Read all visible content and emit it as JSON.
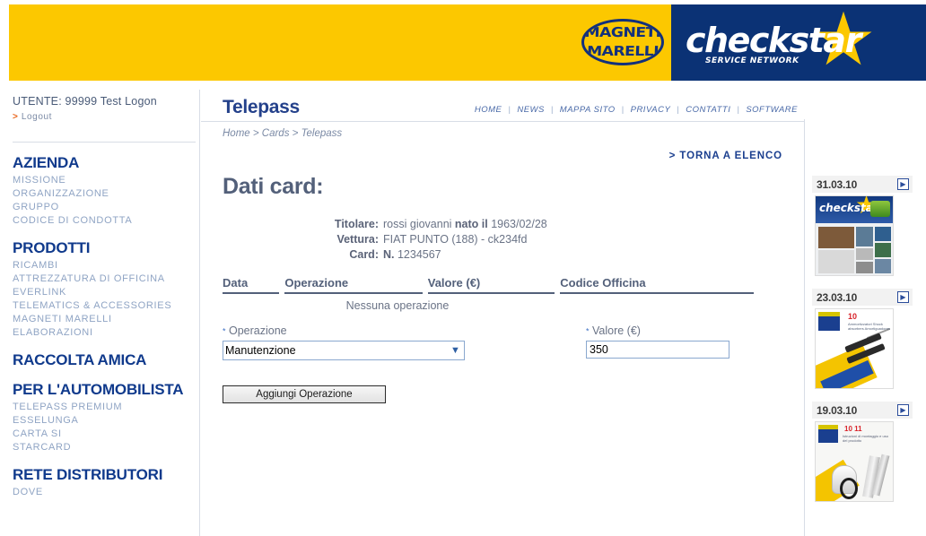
{
  "header": {
    "magneti_line1": "MAGNETI",
    "magneti_line2": "MARELLI",
    "checkstar_word": "checkstar",
    "checkstar_sub": "SERVICE NETWORK",
    "yellow": "#fcc800",
    "blue": "#0b3275"
  },
  "sidebar": {
    "user_label": "UTENTE: 99999 Test Logon",
    "logout_arrow": ">",
    "logout_label": "Logout",
    "groups": [
      {
        "head": "AZIENDA",
        "items": [
          "MISSIONE",
          "ORGANIZZAZIONE",
          "GRUPPO",
          "CODICE DI CONDOTTA"
        ]
      },
      {
        "head": "PRODOTTI",
        "items": [
          "RICAMBI",
          "ATTREZZATURA DI OFFICINA",
          "EVERLINK",
          "TELEMATICS & ACCESSORIES",
          "MAGNETI MARELLI",
          "ELABORAZIONI"
        ]
      },
      {
        "head": "RACCOLTA AMICA",
        "items": []
      },
      {
        "head": "PER L'AUTOMOBILISTA",
        "items": [
          "TELEPASS PREMIUM",
          "ESSELUNGA",
          "CARTA SI",
          "STARCARD"
        ]
      },
      {
        "head": "RETE DISTRIBUTORI",
        "items": [
          "DOVE"
        ]
      }
    ]
  },
  "main": {
    "page_title": "Telepass",
    "topnav": [
      "HOME",
      "NEWS",
      "MAPPA SITO",
      "PRIVACY",
      "CONTATTI",
      "SOFTWARE"
    ],
    "breadcrumb": "Home > Cards > Telepass",
    "back_link": "> TORNA A ELENCO",
    "section_title": "Dati card:",
    "card_info": [
      {
        "label": "Titolare:",
        "value": "rossi giovanni ",
        "bold_mid": "nato il",
        "value2": " 1963/02/28"
      },
      {
        "label": "Vettura:",
        "value": "FIAT PUNTO (188) - ck234fd",
        "bold_mid": "",
        "value2": ""
      },
      {
        "label": "Card:",
        "value": "",
        "bold_mid": "N.",
        "value2": " 1234567"
      }
    ],
    "table": {
      "columns": [
        "Data",
        "Operazione",
        "Valore (€)",
        "Codice Officina"
      ],
      "empty_message": "Nessuna operazione",
      "rows": []
    },
    "form": {
      "operazione_label": "Operazione",
      "valore_label": "Valore (€)",
      "required_marker": "*",
      "operazione_value": "Manutenzione",
      "operazione_options": [
        "Manutenzione"
      ],
      "valore_value": "350",
      "submit_label": "Aggiungi Operazione"
    }
  },
  "rightcol": {
    "news": [
      {
        "date": "31.03.10",
        "play_icon": "▶"
      },
      {
        "date": "23.03.10",
        "play_icon": "▶"
      },
      {
        "date": "19.03.10",
        "play_icon": "▶"
      }
    ],
    "thumb1": {
      "logo": "checkstar",
      "star": "★"
    },
    "thumb2": {
      "red_number": "10",
      "caption": "Ammortizzatori Shock absorbers Amortiguadores"
    },
    "thumb3": {
      "red_number": "10 11",
      "caption": "Istruzioni di montaggio e uso del prodotto"
    }
  }
}
